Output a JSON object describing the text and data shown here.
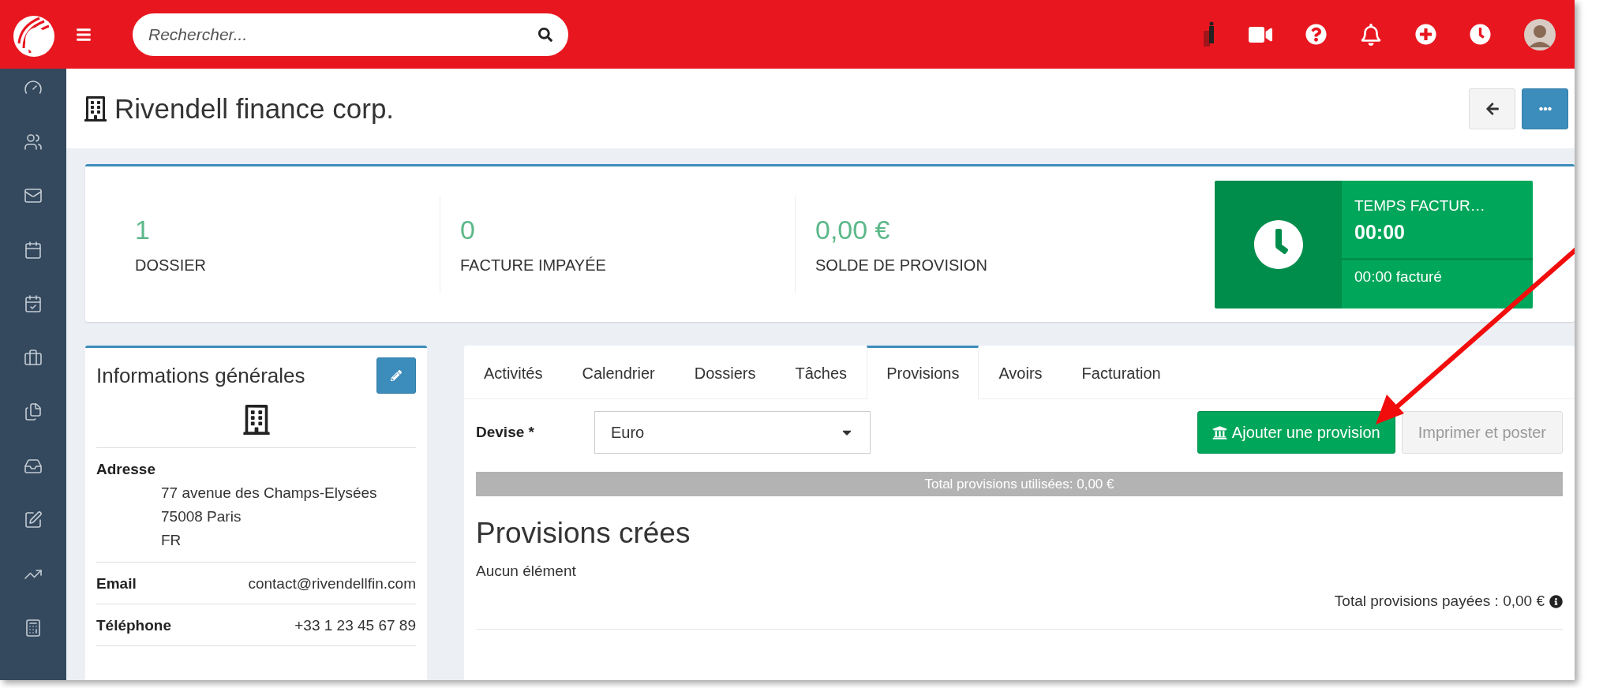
{
  "topbar": {
    "search": {
      "placeholder": "Rechercher..."
    }
  },
  "page": {
    "title": "Rivendell finance corp."
  },
  "stats": [
    {
      "value": "1",
      "label": "DOSSIER"
    },
    {
      "value": "0",
      "label": "FACTURE IMPAYÉE"
    },
    {
      "value": "0,00 €",
      "label": "SOLDE DE PROVISION"
    }
  ],
  "timer": {
    "title": "TEMPS FACTUR…",
    "value": "00:00",
    "billed": "00:00 facturé"
  },
  "general_info": {
    "title": "Informations générales",
    "address_label": "Adresse",
    "address_lines": [
      "77 avenue des Champs-Elysées",
      "75008 Paris",
      "FR"
    ],
    "fields": [
      {
        "label": "Email",
        "value": "contact@rivendellfin.com"
      },
      {
        "label": "Téléphone",
        "value": "+33 1 23 45 67 89"
      }
    ]
  },
  "tabs": [
    {
      "label": "Activités",
      "selected": false
    },
    {
      "label": "Calendrier",
      "selected": false
    },
    {
      "label": "Dossiers",
      "selected": false
    },
    {
      "label": "Tâches",
      "selected": false
    },
    {
      "label": "Provisions",
      "selected": true
    },
    {
      "label": "Avoirs",
      "selected": false
    },
    {
      "label": "Facturation",
      "selected": false
    }
  ],
  "provisions": {
    "currency_label": "Devise *",
    "currency": "Euro",
    "add_button": "Ajouter une provision",
    "print_button": {
      "label": "Imprimer et poster",
      "disabled": true
    },
    "used_total": "Total provisions utilisées: 0,00 €",
    "heading": "Provisions crées",
    "empty": "Aucun élément",
    "paid_total": "Total provisions payées : 0,00 €"
  }
}
